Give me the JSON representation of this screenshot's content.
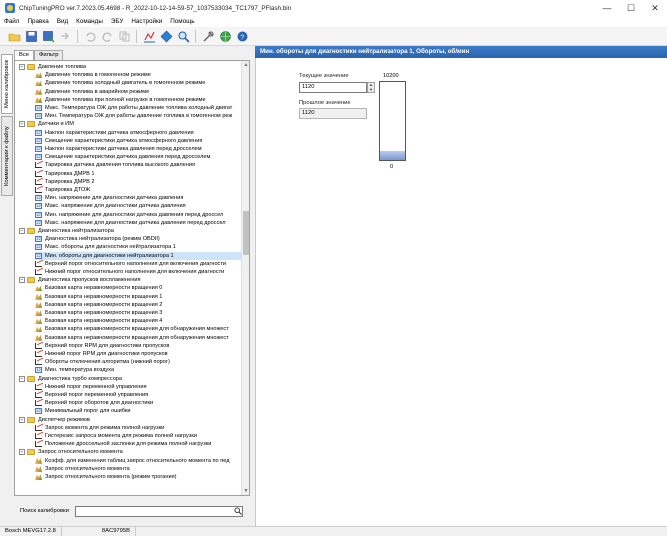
{
  "window": {
    "title": "ChipTuningPRO ver.7.2023.05.4698 - R_2022-10-12-14-59-57_1037533034_TC1797_PFlash.bin",
    "controls": [
      "—",
      "☐",
      "✕"
    ]
  },
  "menu": [
    "Файл",
    "Правка",
    "Вид",
    "Команды",
    "ЭБУ",
    "Настройки",
    "Помощь"
  ],
  "toolbar": {
    "icons": [
      "open-icon",
      "save-icon",
      "save-as-icon",
      "export-icon",
      "undo-icon",
      "redo-icon",
      "copy-icon",
      "checksum-icon",
      "compare-icon",
      "search-icon",
      "tools-icon",
      "globe-icon",
      "help-icon"
    ]
  },
  "side_tabs": [
    "Меню калибровок",
    "Комментарии к файлу"
  ],
  "panel_tabs": [
    "Все",
    "Фильтр"
  ],
  "tree": [
    {
      "level": 0,
      "type": "folder",
      "label": "Давление топлива"
    },
    {
      "level": 1,
      "type": "map",
      "label": "Давление топлива в гомогенном режиме"
    },
    {
      "level": 1,
      "type": "map",
      "label": "Давление топлива холодный двигатель в гомогенном режиме"
    },
    {
      "level": 1,
      "type": "map",
      "label": "Давление топлива в аварийном режиме"
    },
    {
      "level": 1,
      "type": "map",
      "label": "Давление топлива при полной нагрузке в гомогенном режиме"
    },
    {
      "level": 1,
      "type": "val",
      "label": "Макс. Температура ОЖ для работы давление топлива холодный двигат"
    },
    {
      "level": 1,
      "type": "val",
      "label": "Мин. Температура ОЖ для работы давление топлива в гомогенном реж"
    },
    {
      "level": 0,
      "type": "folder",
      "label": "Датчики и ИМ"
    },
    {
      "level": 1,
      "type": "val",
      "label": "Наклон характеристики датчика атмосферного давления"
    },
    {
      "level": 1,
      "type": "val",
      "label": "Смещение характеристики датчика атмосферного давления"
    },
    {
      "level": 1,
      "type": "val",
      "label": "Наклон характеристики датчика давления перед дросселем"
    },
    {
      "level": 1,
      "type": "val",
      "label": "Смещение характеристики датчика давления перед дросселем"
    },
    {
      "level": 1,
      "type": "curve",
      "label": "Тарировка датчика давления топлива высокого давления"
    },
    {
      "level": 1,
      "type": "curve",
      "label": "Тарировка ДМРВ 1"
    },
    {
      "level": 1,
      "type": "curve",
      "label": "Тарировка ДМРВ 2"
    },
    {
      "level": 1,
      "type": "curve",
      "label": "Тарировка ДТОЖ"
    },
    {
      "level": 1,
      "type": "val",
      "label": "Мин. напряжение для диагностики датчика давления"
    },
    {
      "level": 1,
      "type": "val",
      "label": "Макс. напряжение для диагностики датчика давления"
    },
    {
      "level": 1,
      "type": "val",
      "label": "Мин. напряжение для диагностики датчика  давления перед дроссел"
    },
    {
      "level": 1,
      "type": "val",
      "label": "Макс. напряжение для диагностики датчика давления перед дроссел"
    },
    {
      "level": 0,
      "type": "folder",
      "label": "Диагностика нейтрализатора"
    },
    {
      "level": 1,
      "type": "val",
      "label": "Диагностика нейтрализатора (режим OBDII)"
    },
    {
      "level": 1,
      "type": "val",
      "label": "Макс. обороты для диагностики нейтрализатора 1"
    },
    {
      "level": 1,
      "type": "val",
      "label": "Мин. обороты для диагностики нейтрализатора 1",
      "selected": true
    },
    {
      "level": 1,
      "type": "curve",
      "label": "Верхний порог относительного наполнения для включения диагности"
    },
    {
      "level": 1,
      "type": "curve",
      "label": "Нижний порог относительного наполнения для включения диагности"
    },
    {
      "level": 0,
      "type": "folder",
      "label": "Диагностика пропусков воспламенения"
    },
    {
      "level": 1,
      "type": "map",
      "label": "Базовая карта неравномерности вращения 0"
    },
    {
      "level": 1,
      "type": "map",
      "label": "Базовая карта неравномерности вращения 1"
    },
    {
      "level": 1,
      "type": "map",
      "label": "Базовая карта неравномерности вращения 2"
    },
    {
      "level": 1,
      "type": "map",
      "label": "Базовая карта неравномерности вращения 3"
    },
    {
      "level": 1,
      "type": "map",
      "label": "Базовая карта неравномерности вращения 4"
    },
    {
      "level": 1,
      "type": "map",
      "label": "Базовая карта неравномерности вращения для обнаружения множест"
    },
    {
      "level": 1,
      "type": "map",
      "label": "Базовая карта неравномерности вращения для обнаружения множест"
    },
    {
      "level": 1,
      "type": "curve",
      "label": "Верхний порог RPM для диагностики пропусков"
    },
    {
      "level": 1,
      "type": "curve",
      "label": "Нижний порог RPM для диагностики пропусков"
    },
    {
      "level": 1,
      "type": "curve",
      "label": "Обороты отключения алгоритма (нижний порог)"
    },
    {
      "level": 1,
      "type": "val",
      "label": "Мин. температура воздуха"
    },
    {
      "level": 0,
      "type": "folder",
      "label": "Диагностика турбо компрессора"
    },
    {
      "level": 1,
      "type": "curve",
      "label": "Нижний порог переменной управления"
    },
    {
      "level": 1,
      "type": "curve",
      "label": "Верхний порог переменной управления"
    },
    {
      "level": 1,
      "type": "curve",
      "label": "Верхний порог оборотов для диагностики"
    },
    {
      "level": 1,
      "type": "val",
      "label": "Минимальный порог для ошибки"
    },
    {
      "level": 0,
      "type": "folder",
      "label": "Диспетчер режимов"
    },
    {
      "level": 1,
      "type": "curve",
      "label": "Запрос момента для режима полной нагрузки"
    },
    {
      "level": 1,
      "type": "curve",
      "label": "Гистерезис запроса момента для режима полной нагрузки"
    },
    {
      "level": 1,
      "type": "curve",
      "label": "Положение дроссельной заслонки для режима полной нагрузки"
    },
    {
      "level": 0,
      "type": "folder",
      "label": "Запрос относительного момента"
    },
    {
      "level": 1,
      "type": "map",
      "label": "Коэфф. для изменения таблиц запрос относительного момента по пед"
    },
    {
      "level": 1,
      "type": "map",
      "label": "Запрос относительного момента"
    },
    {
      "level": 1,
      "type": "map",
      "label": "Запрос относительного момента (режим трогания)"
    }
  ],
  "search": {
    "label": "Поиск калибровки",
    "value": ""
  },
  "detail": {
    "header": "Мин. обороты для диагностики нейтрализатора 1, Обороты, об/мин",
    "current_label": "Текущее значение",
    "current_value": "1120",
    "previous_label": "Прошлое значение",
    "previous_value": "1120",
    "gauge_max": "10200",
    "gauge_min": "0",
    "gauge_value": 1120,
    "gauge_max_value": 10200
  },
  "status": {
    "ecu": "Bosch MEVG17.2.8",
    "checksum": "8AC9795B"
  }
}
